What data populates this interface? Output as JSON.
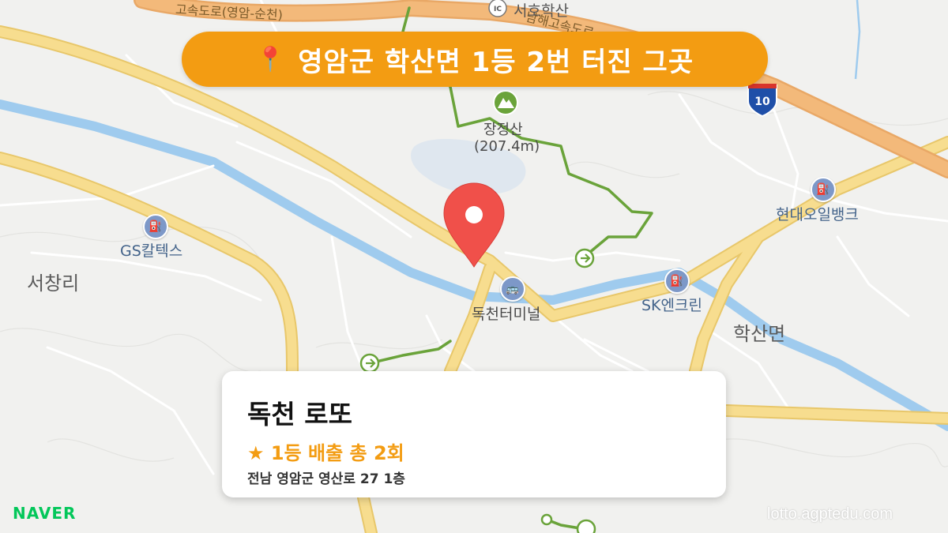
{
  "banner": {
    "icon": "📍",
    "text": "영암군 학산면 1등 2번 터진 그곳"
  },
  "card": {
    "title": "독천 로또",
    "stat_icon": "★",
    "stat_text": "1등 배출 총 2회",
    "address": "전남 영암군 영산로 27 1층"
  },
  "map": {
    "places": [
      "서창리",
      "학산면"
    ],
    "pois": {
      "gs": "GS칼텍스",
      "hyundai": "현대오일뱅크",
      "sk": "SK엔크린",
      "terminal": "독천터미널",
      "mountain_name": "장정산",
      "mountain_height": "(207.4m)",
      "ic": "서호학산",
      "ic_badge": "IC"
    },
    "roads": {
      "top_left": "고속도로(영암-순천)",
      "top_right": "남해고속도로",
      "route_shield": "10"
    },
    "colors": {
      "background": "#f1f1ef",
      "road": "#f7dd8f",
      "highway": "#f3b97a",
      "water": "#9fcbee",
      "trail": "#6aa33a",
      "marker": "#f0504a"
    }
  },
  "branding": {
    "provider": "NAVER",
    "watermark": "lotto.agptedu.com"
  }
}
